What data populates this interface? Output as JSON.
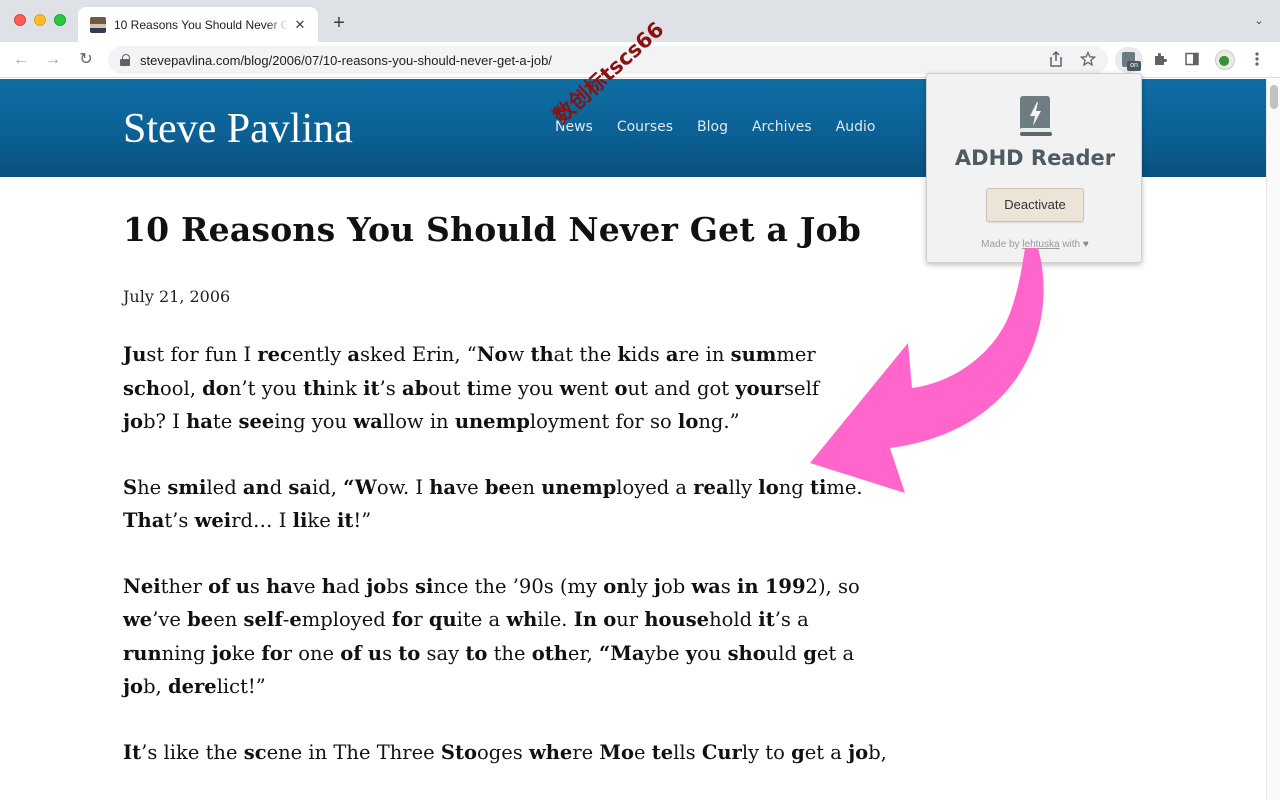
{
  "browser": {
    "tab": {
      "title": "10 Reasons You Should Never Get a Job",
      "close_glyph": "✕"
    },
    "new_tab_glyph": "+",
    "tab_search_glyph": "⌄",
    "nav": {
      "back_glyph": "←",
      "forward_glyph": "→",
      "reload_glyph": "↻"
    },
    "url": "stevepavlina.com/blog/2006/07/10-reasons-you-should-never-get-a-job/",
    "extension_badge": "on"
  },
  "site": {
    "title": "Steve Pavlina",
    "nav": [
      "News",
      "Courses",
      "Blog",
      "Archives",
      "Audio"
    ]
  },
  "article": {
    "title": "10 Reasons You Should Never Get a Job",
    "date": "July 21, 2006",
    "paragraphs": [
      [
        [
          [
            "Ju",
            "st for fun I "
          ],
          [
            "rec",
            "ently "
          ],
          [
            "a",
            "sked Erin, “"
          ],
          [
            "No",
            "w "
          ],
          [
            "th",
            "at the "
          ],
          [
            "k",
            "ids "
          ],
          [
            "a",
            "re in "
          ],
          [
            "sum",
            "mer"
          ]
        ],
        [
          [
            "sch",
            "ool, "
          ],
          [
            "do",
            "n’t you "
          ],
          [
            "th",
            "ink "
          ],
          [
            "it",
            "’s "
          ],
          [
            "ab",
            "out "
          ],
          [
            "t",
            "ime you "
          ],
          [
            "w",
            "ent "
          ],
          [
            "o",
            "ut and got "
          ],
          [
            "your",
            "self"
          ]
        ],
        [
          [
            "jo",
            "b? I "
          ],
          [
            "ha",
            "te "
          ],
          [
            "see",
            "ing you "
          ],
          [
            "wa",
            "llow in "
          ],
          [
            "unemp",
            "loyment for so "
          ],
          [
            "lo",
            "ng.”"
          ]
        ]
      ],
      [
        [
          [
            "S",
            "he "
          ],
          [
            "smi",
            "led "
          ],
          [
            "an",
            "d "
          ],
          [
            "sa",
            "id, "
          ],
          [
            "“W",
            "ow. I "
          ],
          [
            "ha",
            "ve "
          ],
          [
            "be",
            "en "
          ],
          [
            "unemp",
            "loyed a "
          ],
          [
            "rea",
            "lly "
          ],
          [
            "lo",
            "ng "
          ],
          [
            "ti",
            "me."
          ]
        ],
        [
          [
            "Tha",
            "t’s "
          ],
          [
            "wei",
            "rd… I "
          ],
          [
            "li",
            "ke "
          ],
          [
            "it",
            "!”"
          ]
        ]
      ],
      [
        [
          [
            "Nei",
            "ther "
          ],
          [
            "of",
            " "
          ],
          [
            "u",
            "s "
          ],
          [
            "ha",
            "ve "
          ],
          [
            "h",
            "ad "
          ],
          [
            "jo",
            "bs "
          ],
          [
            "si",
            "nce the ’90s (my "
          ],
          [
            "on",
            "ly "
          ],
          [
            "j",
            "ob "
          ],
          [
            "wa",
            "s "
          ],
          [
            "in",
            " "
          ],
          [
            "199",
            "2), so"
          ]
        ],
        [
          [
            "we",
            "’ve "
          ],
          [
            "be",
            "en "
          ],
          [
            "self",
            "-"
          ],
          [
            "e",
            "mployed "
          ],
          [
            "fo",
            "r "
          ],
          [
            "qu",
            "ite a "
          ],
          [
            "wh",
            "ile. "
          ],
          [
            "In",
            " "
          ],
          [
            "o",
            "ur "
          ],
          [
            "house",
            "hold "
          ],
          [
            "it",
            "’s a"
          ]
        ],
        [
          [
            "run",
            "ning "
          ],
          [
            "jo",
            "ke "
          ],
          [
            "fo",
            "r one "
          ],
          [
            "of",
            " "
          ],
          [
            "u",
            "s "
          ],
          [
            "to",
            " say "
          ],
          [
            "to",
            " the "
          ],
          [
            "oth",
            "er, "
          ],
          [
            "“Ma",
            "ybe "
          ],
          [
            "y",
            "ou "
          ],
          [
            "sho",
            "uld "
          ],
          [
            "g",
            "et a"
          ]
        ],
        [
          [
            "jo",
            "b, "
          ],
          [
            "dere",
            "lict!”"
          ]
        ]
      ],
      [
        [
          [
            "It",
            "’s like the "
          ],
          [
            "sc",
            "ene in The Three "
          ],
          [
            "Sto",
            "oges "
          ],
          [
            "whe",
            "re "
          ],
          [
            "Mo",
            "e "
          ],
          [
            "te",
            "lls "
          ],
          [
            "Cur",
            "ly to "
          ],
          [
            "g",
            "et a "
          ],
          [
            "jo",
            "b,"
          ]
        ]
      ]
    ]
  },
  "extension_popup": {
    "name": "ADHD Reader",
    "button": "Deactivate",
    "credit_prefix": "Made by ",
    "credit_link": "lehtuska",
    "credit_suffix": " with ",
    "credit_heart": "♥"
  },
  "watermark": "数创标tscs66",
  "colors": {
    "site_header": "#0b5f93",
    "arrow": "#ff66cc",
    "popup_title": "#4f5b60"
  }
}
